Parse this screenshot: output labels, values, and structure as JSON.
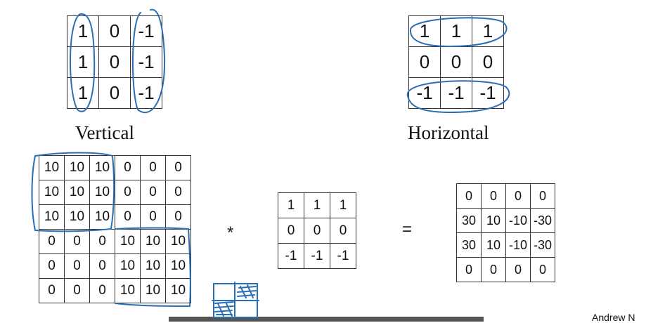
{
  "vertical_filter": {
    "caption": "Vertical",
    "rows": [
      [
        "1",
        "0",
        "-1"
      ],
      [
        "1",
        "0",
        "-1"
      ],
      [
        "1",
        "0",
        "-1"
      ]
    ]
  },
  "horizontal_filter": {
    "caption": "Horizontal",
    "rows": [
      [
        "1",
        "1",
        "1"
      ],
      [
        "0",
        "0",
        "0"
      ],
      [
        "-1",
        "-1",
        "-1"
      ]
    ]
  },
  "example": {
    "image": {
      "rows": [
        [
          "10",
          "10",
          "10",
          "0",
          "0",
          "0"
        ],
        [
          "10",
          "10",
          "10",
          "0",
          "0",
          "0"
        ],
        [
          "10",
          "10",
          "10",
          "0",
          "0",
          "0"
        ],
        [
          "0",
          "0",
          "0",
          "10",
          "10",
          "10"
        ],
        [
          "0",
          "0",
          "0",
          "10",
          "10",
          "10"
        ],
        [
          "0",
          "0",
          "0",
          "10",
          "10",
          "10"
        ]
      ]
    },
    "conv_operator": "*",
    "filter": {
      "rows": [
        [
          "1",
          "1",
          "1"
        ],
        [
          "0",
          "0",
          "0"
        ],
        [
          "-1",
          "-1",
          "-1"
        ]
      ]
    },
    "equals_operator": "=",
    "output": {
      "rows": [
        [
          "0",
          "0",
          "0",
          "0"
        ],
        [
          "30",
          "10",
          "-10",
          "-30"
        ],
        [
          "30",
          "10",
          "-10",
          "-30"
        ],
        [
          "0",
          "0",
          "0",
          "0"
        ]
      ]
    }
  },
  "credit": "Andrew N",
  "ink_color": "#2a6fb5"
}
